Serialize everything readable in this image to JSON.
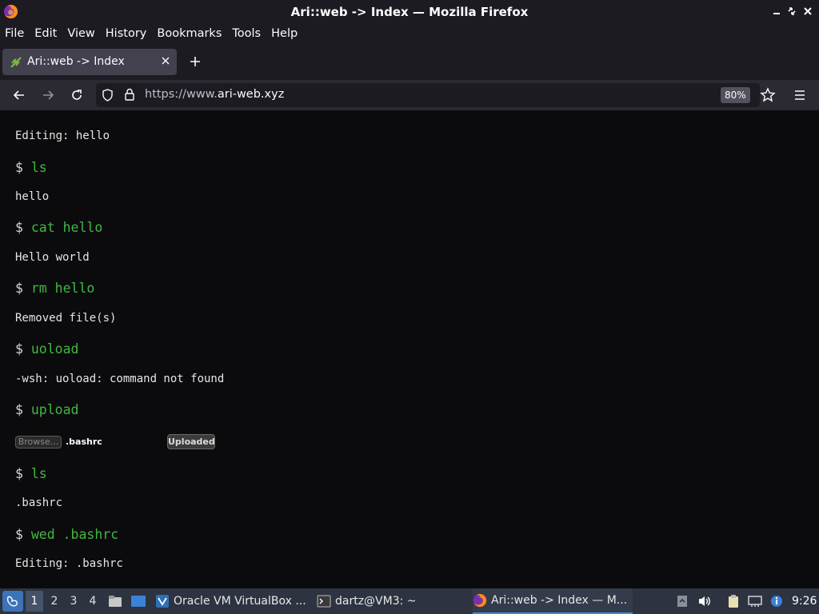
{
  "window": {
    "title": "Ari::web -> Index — Mozilla Firefox"
  },
  "menu": [
    "File",
    "Edit",
    "View",
    "History",
    "Bookmarks",
    "Tools",
    "Help"
  ],
  "tab": {
    "title": "Ari::web -> Index"
  },
  "urlbar": {
    "scheme": "https://www.",
    "domain": "ari-web.xyz",
    "zoom": "80%"
  },
  "terminal": {
    "lines": [
      {
        "type": "out",
        "text": "Editing: hello"
      },
      {
        "type": "prompt",
        "symbol": "$ ",
        "cmd": "ls"
      },
      {
        "type": "out",
        "text": "hello"
      },
      {
        "type": "prompt",
        "symbol": "$ ",
        "cmd": "cat hello"
      },
      {
        "type": "out",
        "text": "Hello world"
      },
      {
        "type": "prompt",
        "symbol": "$ ",
        "cmd": "rm hello"
      },
      {
        "type": "out",
        "text": "Removed file(s)"
      },
      {
        "type": "prompt",
        "symbol": "$ ",
        "cmd": "uoload"
      },
      {
        "type": "out",
        "text": "-wsh: uoload: command not found"
      },
      {
        "type": "prompt",
        "symbol": "$ ",
        "cmd": "upload"
      },
      {
        "type": "prompt",
        "symbol": "$ ",
        "cmd": "ls"
      },
      {
        "type": "out",
        "text": ".bashrc"
      },
      {
        "type": "prompt",
        "symbol": "$ ",
        "cmd": "wed .bashrc"
      },
      {
        "type": "out",
        "text": "Editing: .bashrc"
      }
    ],
    "upload": {
      "browse_label": "Browse...",
      "filename": ".bashrc",
      "status_label": "Uploaded"
    }
  },
  "taskbar": {
    "workspaces": [
      "1",
      "2",
      "3",
      "4"
    ],
    "active_workspace": "1",
    "tasks": [
      {
        "label": "Oracle VM VirtualBox ...",
        "icon": "virtualbox-icon"
      },
      {
        "label": "dartz@VM3: ~",
        "icon": "terminal-icon"
      },
      {
        "label": "Ari::web -> Index — M...",
        "icon": "firefox-icon",
        "active": true
      }
    ],
    "clock": "9:26"
  },
  "colors": {
    "prompt_command": "#3fb93f",
    "accent": "#3c8ad8"
  }
}
